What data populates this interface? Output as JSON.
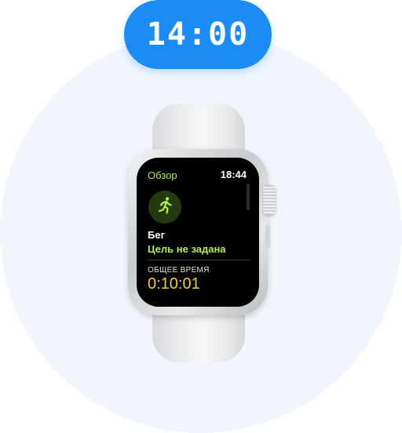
{
  "clock_badge": {
    "time": "14:00"
  },
  "watch": {
    "header": {
      "title": "Обзор",
      "time": "18:44"
    },
    "activity": {
      "icon": "running-figure-icon",
      "name": "Бег",
      "goal": "Цель не задана"
    },
    "metric": {
      "label": "ОБЩЕЕ ВРЕМЯ",
      "value": "0:10:01"
    }
  },
  "colors": {
    "accent_blue": "#1b8cf5",
    "activity_green": "#b6f23c",
    "metric_yellow": "#f3cc2f",
    "background_circle": "#f1f6fd"
  }
}
